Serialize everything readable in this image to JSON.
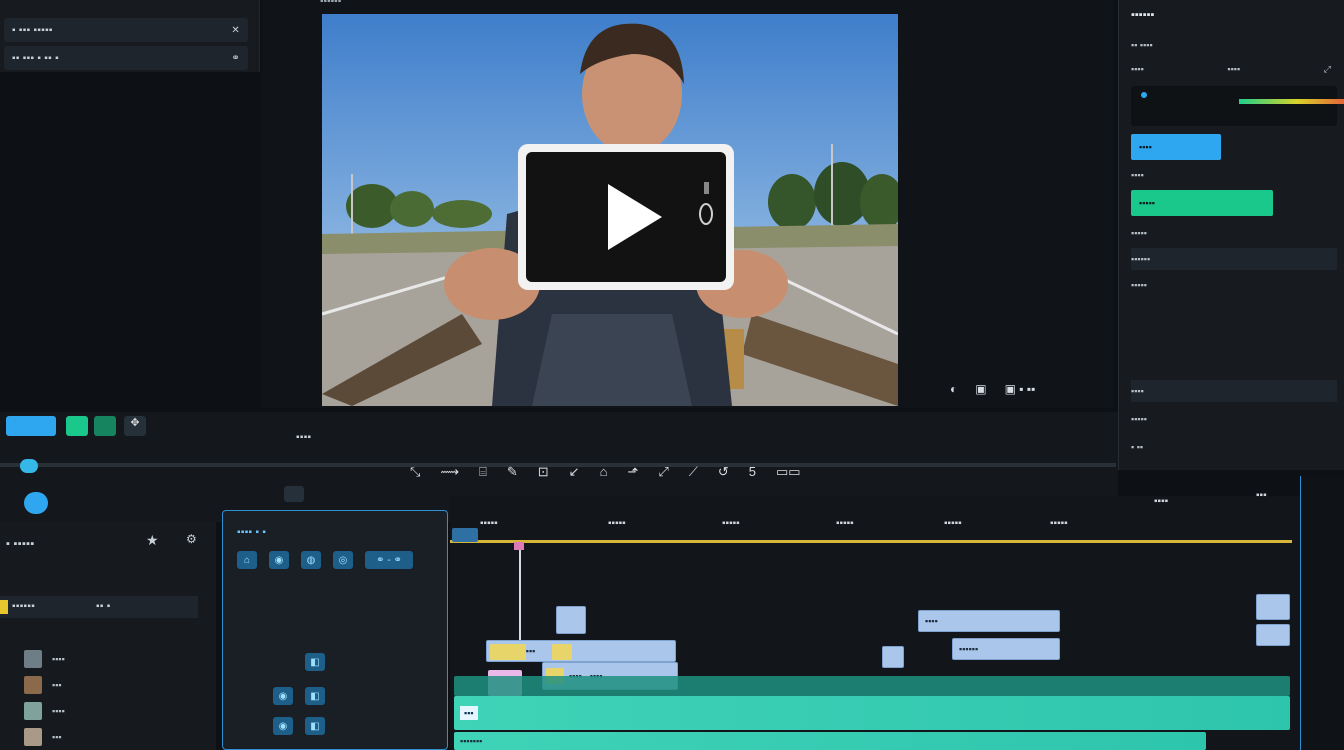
{
  "topleft": {
    "row1": "▪ ▪▪▪ ▪▪▪▪▪",
    "row2": "▪▪ ▪▪▪ ▪ ▪▪ ▪"
  },
  "viewer": {
    "title": "▪▪▪▪▪▪",
    "controls": [
      "◐",
      "▣",
      "▣ ▪ ▪▪"
    ]
  },
  "inspector": {
    "title": "▪▪▪▪▪▪",
    "subtitle": "▪▪ ▪▪▪▪",
    "tab1": "▪▪▪▪",
    "tab2": "▪▪▪▪",
    "rows": [
      "▪▪▪▪",
      "▪▪▪▪",
      "▪▪▪▪▪",
      "▪▪▪▪▪",
      "▪▪▪▪▪▪",
      "▪▪▪▪▪"
    ],
    "section2": "▪▪▪▪",
    "field1": "▪▪▪▪▪",
    "field2": "▪ ▪▪",
    "colors": {
      "accent_blue": "#2ea7f0",
      "accent_green": "#19c88a"
    }
  },
  "transport": {
    "timecode": "▪▪▪▪",
    "tools": [
      "⤡",
      "⟿",
      "⌸",
      "✎",
      "⊡",
      "↙",
      "⌂",
      "⬏",
      "⤢",
      "⟋",
      "↺",
      "5",
      "▭▭"
    ]
  },
  "media": {
    "title": "▪ ▪▪▪▪▪",
    "items": [
      "▪▪▪▪▪▪",
      "▪▪▪▪",
      "▪▪▪",
      "▪▪▪▪",
      "▪▪▪"
    ],
    "row_tag": "▪▪ ▪"
  },
  "track_head": {
    "title": "▪▪▪▪ ▪ ▪"
  },
  "timeline": {
    "ruler_labels": [
      "▪▪▪▪▪",
      "▪▪▪▪▪",
      "▪▪▪▪▪",
      "▪▪▪▪▪",
      "▪▪▪▪▪",
      "▪▪▪▪▪",
      "▪▪▪▪",
      "▪▪▪"
    ],
    "clips_v2": [
      "▪▪",
      "▪▪",
      "▪▪▪",
      "▪▪▪▪",
      "▪▪▪▪▪▪"
    ],
    "clips_v1": [
      "▪▪▪▪",
      "▪▪▪▪",
      "▪▪▪",
      "▪▪▪▪▪▪▪"
    ]
  }
}
